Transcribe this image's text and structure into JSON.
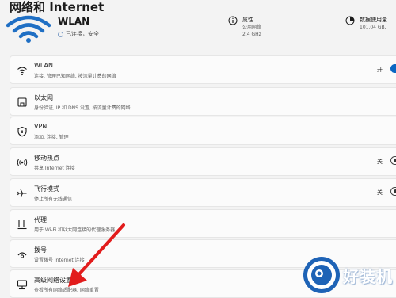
{
  "page_title": "网络和 Internet",
  "hero": {
    "network_name": "WLAN",
    "status": "已连接，安全",
    "properties": {
      "label": "属性",
      "line1": "公用网络",
      "line2": "2.4 GHz"
    },
    "data_usage": {
      "label": "数据使用量",
      "line1": "101.04 GB,",
      "line2": ""
    }
  },
  "items": [
    {
      "title": "WLAN",
      "subtitle": "连接, 管理已知网络, 按流量计费的网络",
      "icon": "wifi-icon",
      "toggle": "开",
      "toggle_state": "on"
    },
    {
      "title": "以太网",
      "subtitle": "身份验证, IP 和 DNS 设置, 按流量计费的网络",
      "icon": "ethernet-icon"
    },
    {
      "title": "VPN",
      "subtitle": "添加, 连接, 管理",
      "icon": "vpn-shield-icon"
    },
    {
      "title": "移动热点",
      "subtitle": "共享 Internet 连接",
      "icon": "hotspot-icon",
      "toggle": "关",
      "toggle_state": "off"
    },
    {
      "title": "飞行模式",
      "subtitle": "停止所有无线通信",
      "icon": "airplane-icon",
      "toggle": "关",
      "toggle_state": "off"
    },
    {
      "title": "代理",
      "subtitle": "用于 Wi-Fi 和以太网连接的代理服务器",
      "icon": "proxy-icon"
    },
    {
      "title": "拨号",
      "subtitle": "设置拨号 Internet 连接",
      "icon": "dialup-icon"
    },
    {
      "title": "高级网络设置",
      "subtitle": "查看所有网络适配器, 网络重置",
      "icon": "advanced-network-icon"
    }
  ],
  "watermark": {
    "text": "好装机"
  },
  "colors": {
    "accent": "#0a66c2",
    "arrow": "#e21c1c",
    "wifi_blue": "#1f6fc4"
  }
}
